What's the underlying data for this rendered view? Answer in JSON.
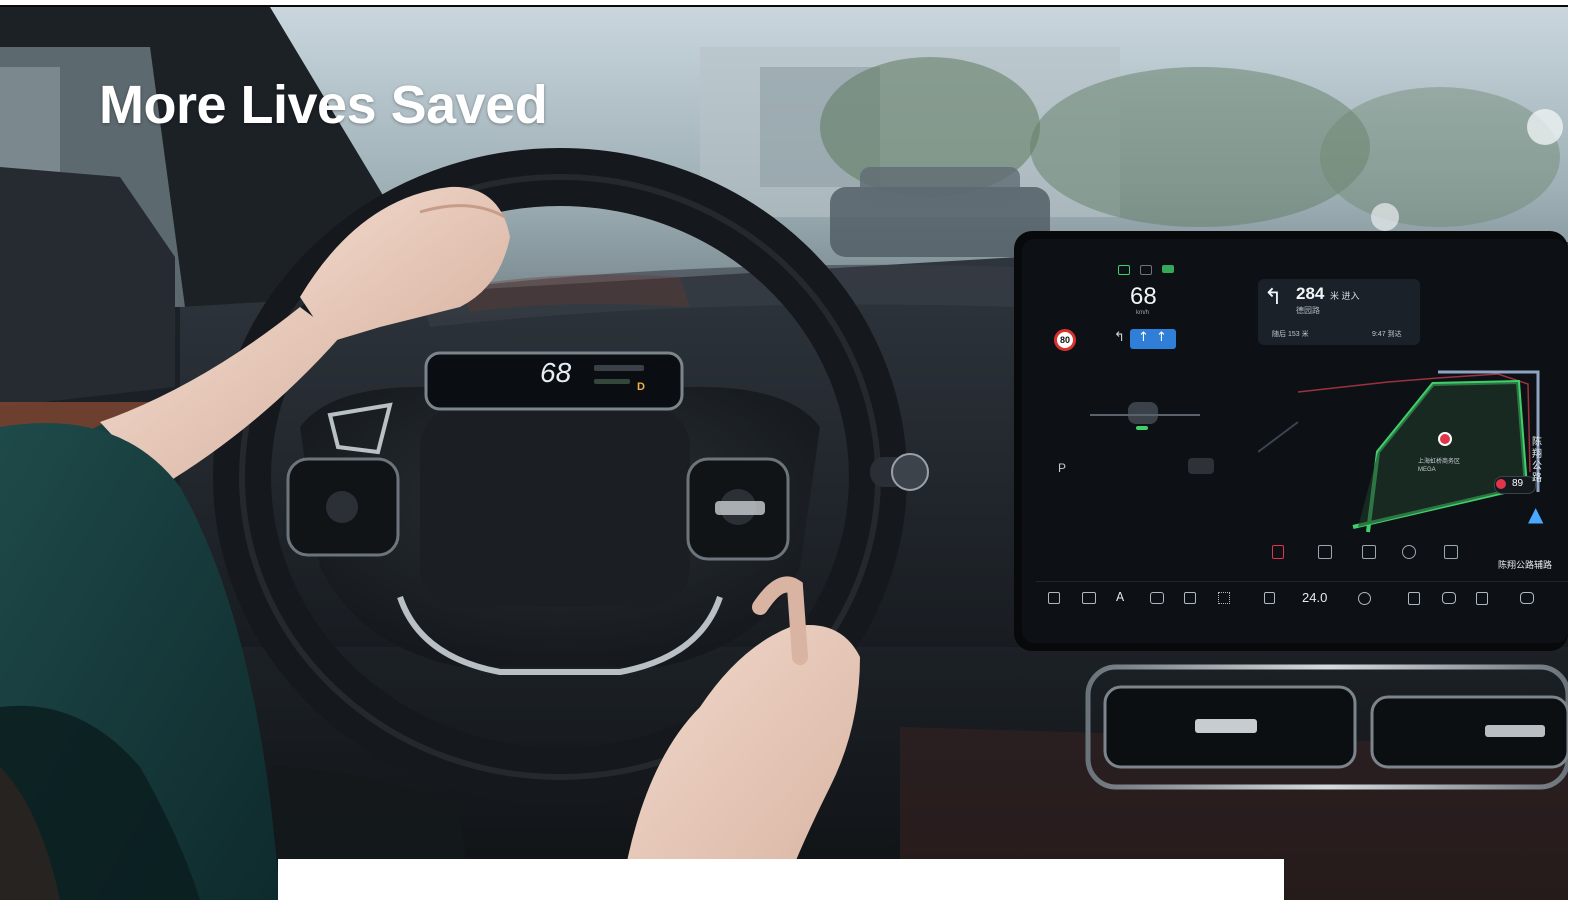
{
  "slide": {
    "title": "More Lives Saved"
  },
  "photo": {
    "cluster_speed": "68",
    "cluster_gear": "D",
    "screen": {
      "speed": "68",
      "speed_unit": "km/h",
      "speed_limit": "80",
      "nav_distance": "284",
      "nav_unit_action": "米 进入",
      "nav_road": "德园路",
      "nav_next": "随后 153 米",
      "nav_eta": "9:47 到达",
      "map_poi": "上海虹桥商务区 MEGA",
      "map_road_side": "陈翔公路",
      "map_road_bottom": "陈翔公路辅路",
      "map_speed_badge": "89",
      "ac_temp": "24.0",
      "colors": {
        "map_route_green": "#3fd06a",
        "screen_bg": "#0d1116",
        "lane_blue": "#2f7fd8"
      }
    }
  }
}
